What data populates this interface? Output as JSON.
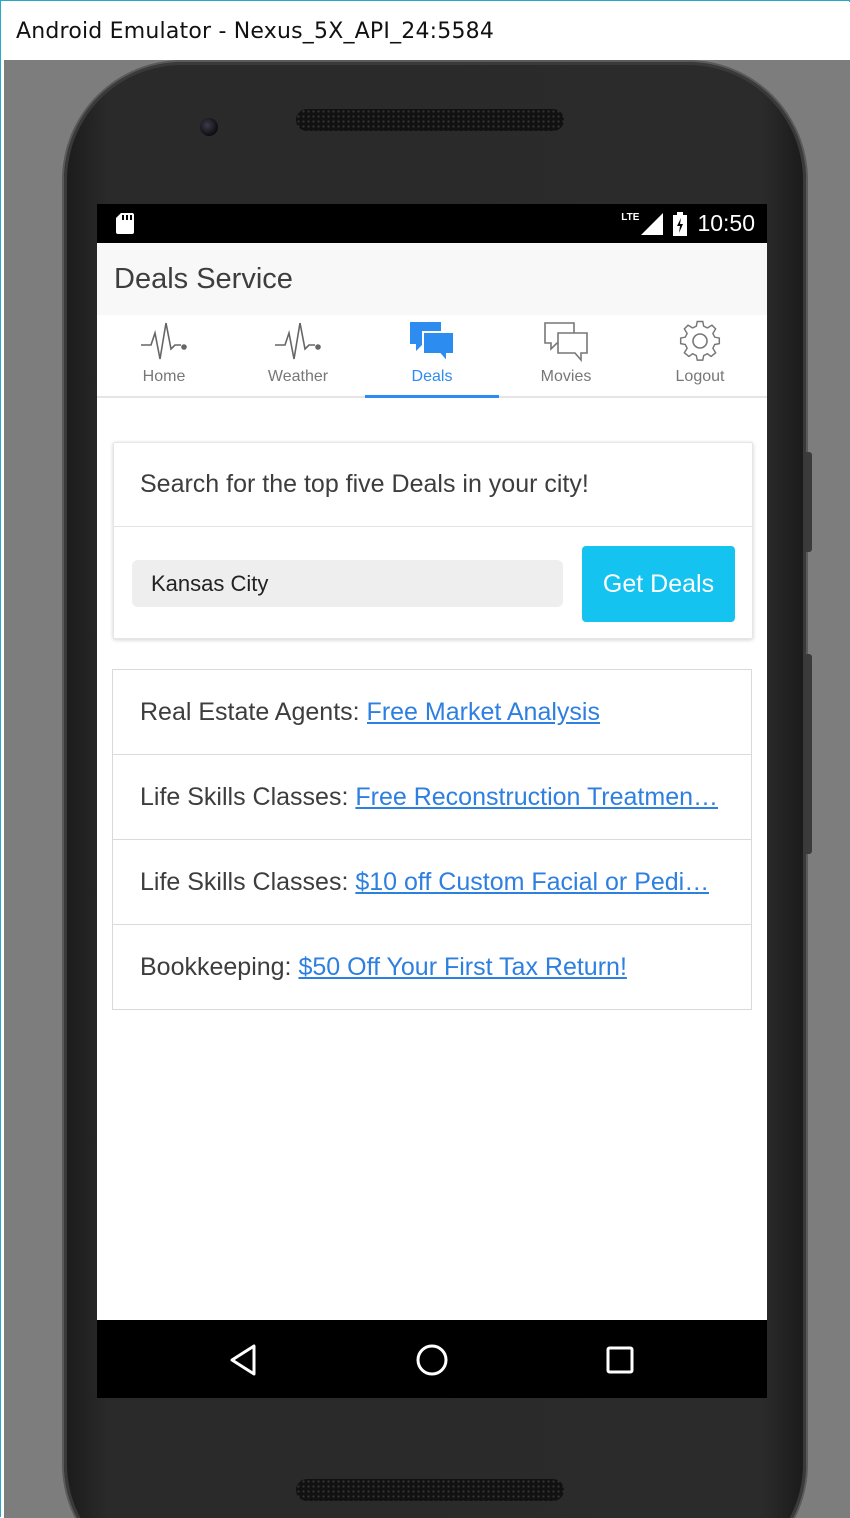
{
  "window": {
    "title": "Android Emulator - Nexus_5X_API_24:5584"
  },
  "status_bar": {
    "network": "LTE",
    "time": "10:50"
  },
  "app": {
    "title": "Deals Service"
  },
  "tabs": [
    {
      "label": "Home",
      "icon": "pulse-icon",
      "active": false
    },
    {
      "label": "Weather",
      "icon": "pulse-icon",
      "active": false
    },
    {
      "label": "Deals",
      "icon": "chat-bubbles-icon",
      "active": true
    },
    {
      "label": "Movies",
      "icon": "chat-bubbles-outline-icon",
      "active": false
    },
    {
      "label": "Logout",
      "icon": "gear-icon",
      "active": false
    }
  ],
  "search": {
    "heading": "Search for the top five Deals in your city!",
    "city_value": "Kansas City",
    "button_label": "Get Deals"
  },
  "deals": [
    {
      "category": "Real Estate Agents:",
      "link": "Free Market Analysis"
    },
    {
      "category": "Life Skills Classes:",
      "link": "Free Reconstruction Treatmen…"
    },
    {
      "category": "Life Skills Classes:",
      "link": "$10 off Custom Facial or Pedi…"
    },
    {
      "category": "Bookkeeping:",
      "link": "$50 Off Your First Tax Return!"
    }
  ],
  "colors": {
    "accent": "#2d8cf0",
    "button": "#14c3f0",
    "link": "#2d7fe0",
    "tab_inactive": "#777777"
  },
  "nav": {
    "back_icon": "back-triangle-icon",
    "home_icon": "home-circle-icon",
    "recents_icon": "recents-square-icon"
  }
}
